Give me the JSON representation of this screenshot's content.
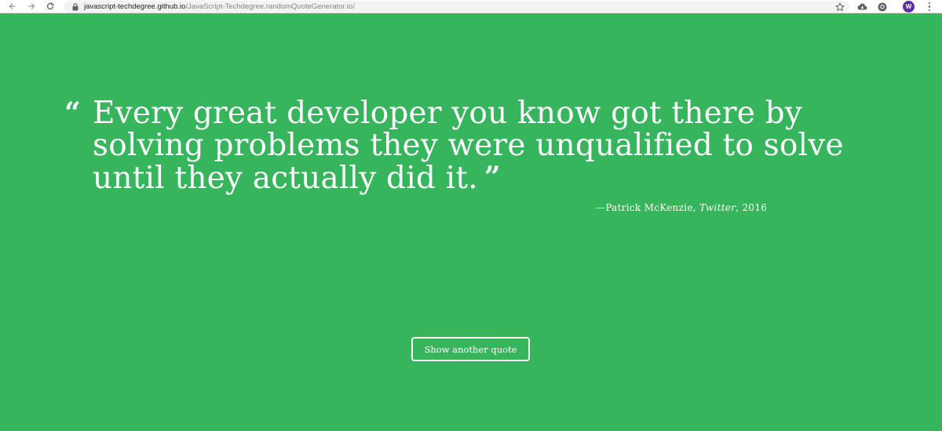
{
  "browser": {
    "url_host": "javascript-techdegree.github.io",
    "url_path": "/JavaScript-Techdegree.randomQuoteGenerator.io/",
    "avatar_letter": "W",
    "icons": [
      "back-arrow-icon",
      "forward-arrow-icon",
      "reload-icon",
      "lock-icon",
      "star-icon",
      "cloud-extension-icon",
      "github-extension-icon",
      "menu-icon"
    ]
  },
  "quote": {
    "open_mark": "“",
    "text": "Every great developer you know got there by solving problems they were unqualified to solve until they actually did it.",
    "close_mark": "”",
    "dash": "—",
    "author": "Patrick McKenzie",
    "separator": ", ",
    "citation": "Twitter",
    "year": "2016"
  },
  "button": {
    "label": "Show another quote"
  },
  "colors": {
    "background": "#36b55c",
    "text": "#ffffff",
    "avatar": "#5a2fa8"
  }
}
